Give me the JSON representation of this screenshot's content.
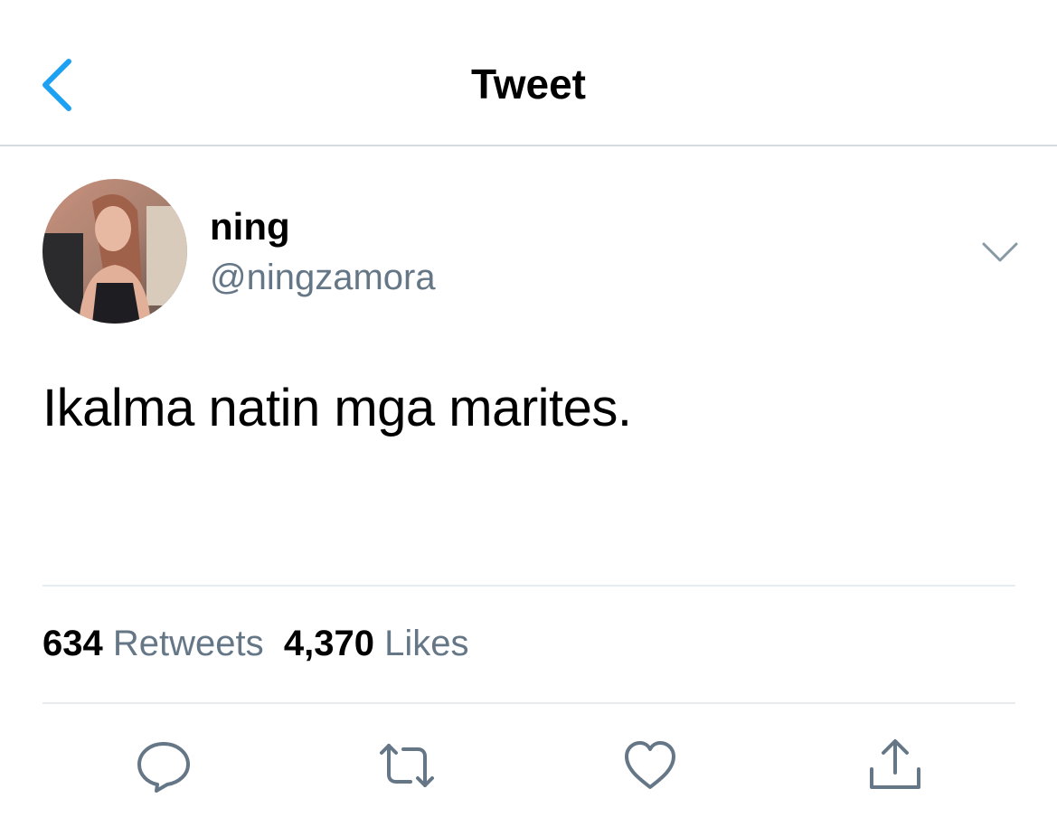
{
  "header": {
    "title": "Tweet",
    "back_icon": "chevron-left-icon",
    "accent_color": "#1da1f2"
  },
  "tweet": {
    "display_name": "ning",
    "username": "@ningzamora",
    "text": "Ikalma natin mga marites.",
    "menu_icon": "chevron-down-icon"
  },
  "stats": {
    "retweets_count": "634",
    "retweets_label": "Retweets",
    "likes_count": "4,370",
    "likes_label": "Likes"
  },
  "actions": [
    {
      "icon": "reply-icon"
    },
    {
      "icon": "retweet-icon"
    },
    {
      "icon": "like-icon"
    },
    {
      "icon": "share-icon"
    }
  ],
  "colors": {
    "text": "#000000",
    "secondary": "#657786",
    "divider": "#e6ecf0",
    "icon": "#657786"
  }
}
